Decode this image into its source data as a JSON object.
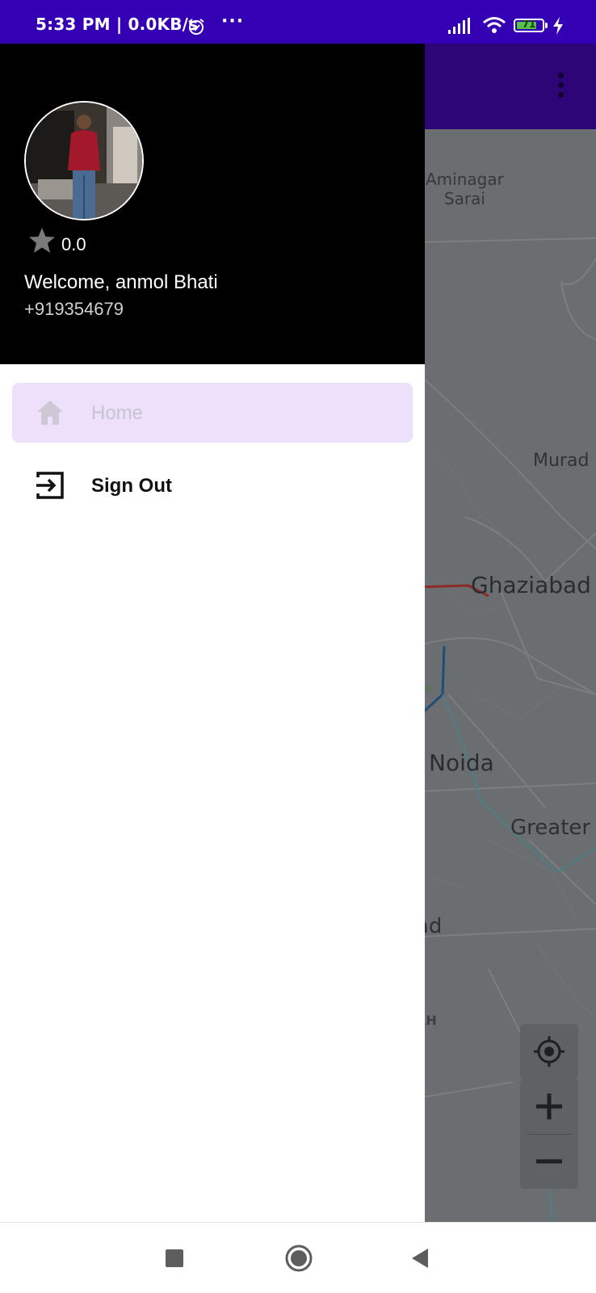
{
  "status_bar": {
    "time": "5:33 PM | 0.0KB/s",
    "more_indicator": "···",
    "battery_level": "71",
    "icons": [
      "alarm-icon",
      "signal-icon",
      "wifi-icon",
      "battery-icon",
      "charging-icon"
    ]
  },
  "drawer": {
    "profile": {
      "rating": "0.0",
      "welcome_text": "Welcome, anmol Bhati",
      "phone": "+919354679"
    },
    "menu": [
      {
        "label": "Home",
        "icon": "home-icon",
        "selected": true
      },
      {
        "label": "Sign Out",
        "icon": "sign-out-icon",
        "selected": false
      }
    ]
  },
  "map": {
    "labels": {
      "aminagar": "Aminagar\nSarai",
      "murad": "Murad",
      "ghaziabad": "Ghaziabad",
      "noida": "Noida",
      "greater": "Greater",
      "ad": "ad",
      "rh": "RH"
    }
  },
  "colors": {
    "status_bar": "#3500b3",
    "toolbar": "#2d0577",
    "drawer_header": "#000000",
    "selected_item_bg": "#ece0fb"
  },
  "nav_bar": {
    "buttons": [
      "recent-apps-button",
      "home-button",
      "back-button"
    ]
  }
}
